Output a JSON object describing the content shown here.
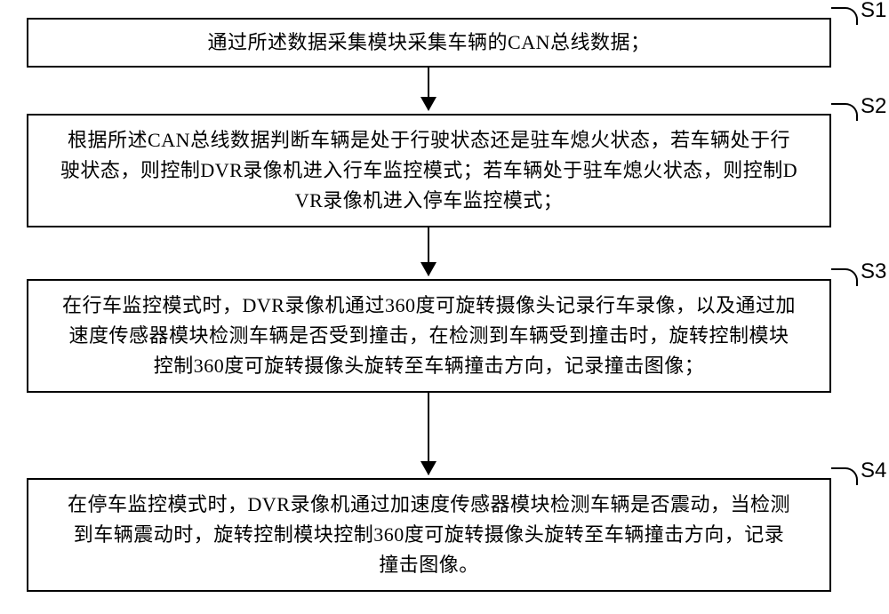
{
  "steps": [
    {
      "id": "S1",
      "text": "通过所述数据采集模块采集车辆的CAN总线数据；"
    },
    {
      "id": "S2",
      "text": "根据所述CAN总线数据判断车辆是处于行驶状态还是驻车熄火状态，若车辆处于行\n驶状态，则控制DVR录像机进入行车监控模式；若车辆处于驻车熄火状态，则控制D\nVR录像机进入停车监控模式；"
    },
    {
      "id": "S3",
      "text": "在行车监控模式时，DVR录像机通过360度可旋转摄像头记录行车录像，以及通过加\n速度传感器模块检测车辆是否受到撞击，在检测到车辆受到撞击时，旋转控制模块\n控制360度可旋转摄像头旋转至车辆撞击方向，记录撞击图像；"
    },
    {
      "id": "S4",
      "text": "在停车监控模式时，DVR录像机通过加速度传感器模块检测车辆是否震动，当检测\n到车辆震动时，旋转控制模块控制360度可旋转摄像头旋转至车辆撞击方向，记录\n撞击图像。"
    }
  ]
}
